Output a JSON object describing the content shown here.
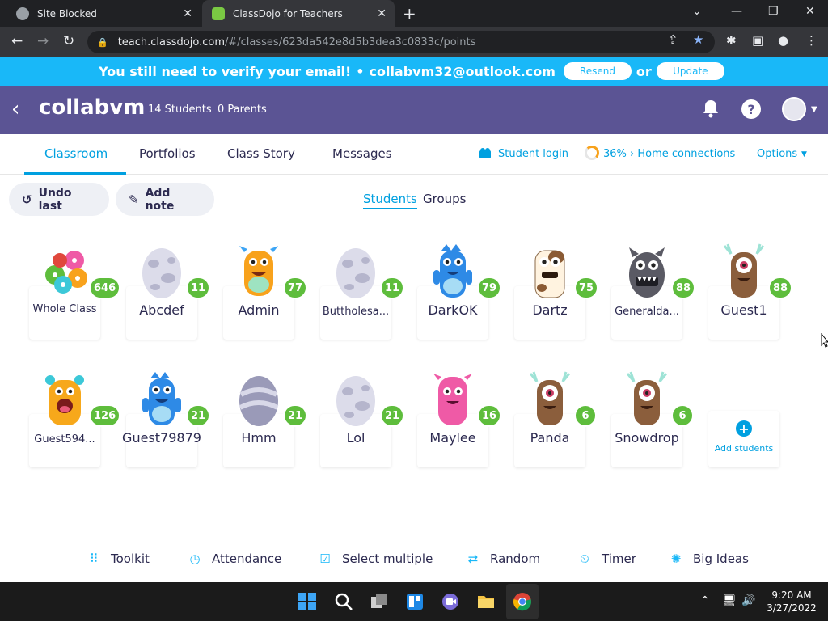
{
  "browser": {
    "tabs": [
      {
        "title": "Site Blocked",
        "active": false
      },
      {
        "title": "ClassDojo for Teachers",
        "active": true
      }
    ],
    "url_host": "teach.classdojo.com",
    "url_path": "/#/classes/623da542e8d5b3dea3c0833c/points"
  },
  "banner": {
    "message": "You still need to verify your email!",
    "bullet": "•",
    "email": "collabvm32@outlook.com",
    "resend": "Resend",
    "or": "or",
    "update": "Update"
  },
  "header": {
    "class_name": "collabvm",
    "students": "14 Students",
    "parents": "0 Parents"
  },
  "nav": {
    "tabs": [
      "Classroom",
      "Portfolios",
      "Class Story",
      "Messages"
    ],
    "active": "Classroom",
    "student_login": "Student login",
    "home_connections": "36% › Home connections",
    "options": "Options"
  },
  "actions": {
    "undo": "Undo last",
    "add_note": "Add note",
    "students": "Students",
    "groups": "Groups"
  },
  "students": [
    {
      "name": "Whole Class",
      "points": "646",
      "monster": "group"
    },
    {
      "name": "Abcdef",
      "points": "11",
      "monster": "egg-light"
    },
    {
      "name": "Admin",
      "points": "77",
      "monster": "orange"
    },
    {
      "name": "Buttholesa...",
      "points": "11",
      "monster": "egg-light"
    },
    {
      "name": "DarkOK",
      "points": "79",
      "monster": "blue"
    },
    {
      "name": "Dartz",
      "points": "75",
      "monster": "cow"
    },
    {
      "name": "Generalda...",
      "points": "88",
      "monster": "gray"
    },
    {
      "name": "Guest1",
      "points": "88",
      "monster": "brown"
    },
    {
      "name": "Guest594...",
      "points": "126",
      "monster": "yellow"
    },
    {
      "name": "Guest79879",
      "points": "21",
      "monster": "blue"
    },
    {
      "name": "Hmm",
      "points": "21",
      "monster": "egg-swirl"
    },
    {
      "name": "Lol",
      "points": "21",
      "monster": "egg-light"
    },
    {
      "name": "Maylee",
      "points": "16",
      "monster": "pink"
    },
    {
      "name": "Panda",
      "points": "6",
      "monster": "brown"
    },
    {
      "name": "Snowdrop",
      "points": "6",
      "monster": "brown"
    }
  ],
  "add_students": "Add students",
  "bottom": {
    "toolkit": "Toolkit",
    "attendance": "Attendance",
    "select_multiple": "Select multiple",
    "random": "Random",
    "timer": "Timer",
    "big_ideas": "Big Ideas"
  },
  "taskbar": {
    "time": "9:20 AM",
    "date": "3/27/2022"
  },
  "colors": {
    "banner": "#19b8f8",
    "header": "#5b5494",
    "accent": "#00a0e0",
    "points": "#5ebd3c"
  }
}
